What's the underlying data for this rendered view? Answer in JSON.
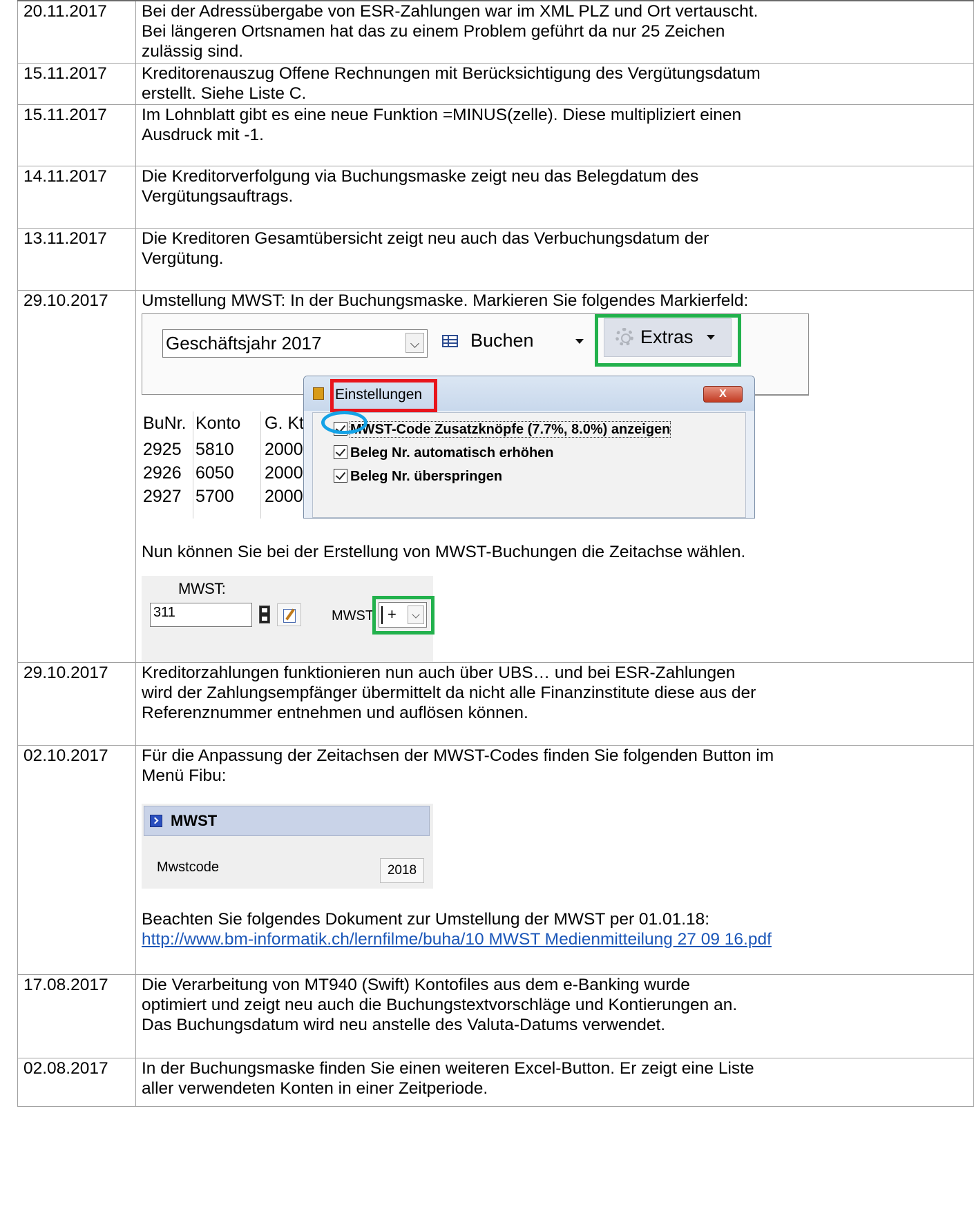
{
  "entries": [
    {
      "date": "20.11.2017",
      "lines": [
        "Bei der Adressübergabe von ESR-Zahlungen war im XML PLZ und Ort vertauscht.",
        "Bei längeren Ortsnamen hat das zu einem Problem geführt da nur 25 Zeichen",
        "zulässig sind."
      ]
    },
    {
      "date": "15.11.2017",
      "lines": [
        "Kreditorenauszug Offene Rechnungen mit Berücksichtigung des Vergütungsdatum",
        "erstellt. Siehe Liste C."
      ]
    },
    {
      "date": "15.11.2017",
      "lines": [
        "Im Lohnblatt gibt es eine neue Funktion  =MINUS(zelle). Diese multipliziert einen",
        "Ausdruck mit -1."
      ]
    },
    {
      "date": "14.11.2017",
      "lines": [
        "Die Kreditorverfolgung via Buchungsmaske zeigt neu das Belegdatum des",
        "Vergütungsauftrags."
      ]
    },
    {
      "date": "13.11.2017",
      "lines": [
        "Die Kreditoren Gesamtübersicht zeigt neu auch das Verbuchungsdatum der",
        "Vergütung."
      ]
    },
    {
      "date": "29.10.2017",
      "lines": [
        "Umstellung MWST: In der Buchungsmaske. Markieren Sie folgendes Markierfeld:"
      ],
      "after_shot1": "Nun können Sie bei der Erstellung von MWST-Buchungen die Zeitachse wählen."
    },
    {
      "date": "29.10.2017",
      "lines": [
        "Kreditorzahlungen funktionieren nun auch über UBS… und bei ESR-Zahlungen",
        "wird der Zahlungsempfänger übermittelt da nicht alle Finanzinstitute diese aus der",
        "Referenznummer entnehmen und auflösen können."
      ]
    },
    {
      "date": "02.10.2017",
      "lines": [
        "Für die Anpassung der Zeitachsen der MWST-Codes finden Sie folgenden Button im",
        "Menü Fibu:"
      ],
      "after_shot": "Beachten Sie folgendes Dokument zur Umstellung der MWST per 01.01.18:",
      "link": "http://www.bm-informatik.ch/lernfilme/buha/10 MWST Medienmitteilung 27 09 16.pdf"
    },
    {
      "date": "17.08.2017",
      "lines": [
        "Die Verarbeitung von MT940 (Swift) Kontofiles aus dem e-Banking wurde",
        "optimiert und zeigt neu auch die Buchungstextvorschläge und Kontierungen an.",
        "Das Buchungsdatum wird neu anstelle des Valuta-Datums verwendet."
      ]
    },
    {
      "date": "02.08.2017",
      "lines": [
        "In der Buchungsmaske finden Sie einen weiteren Excel-Button. Er zeigt eine Liste",
        "aller verwendeten Konten in einer Zeitperiode."
      ]
    }
  ],
  "shot1": {
    "year_combo": "Geschäftsjahr 2017",
    "buchen": "Buchen",
    "extras": "Extras",
    "headers": [
      "BuNr.",
      "Konto",
      "G. Kt"
    ],
    "rows": [
      [
        "2925",
        "5810",
        "2000"
      ],
      [
        "2926",
        "6050",
        "2000"
      ],
      [
        "2927",
        "5700",
        "2000"
      ]
    ],
    "dialog_title": "Einstellungen",
    "dialog_close": "X",
    "options": [
      "MWST-Code Zusatzknöpfe (7.7%, 8.0%) anzeigen",
      "Beleg Nr. automatisch erhöhen",
      "Beleg Nr. überspringen"
    ]
  },
  "shot2": {
    "label": "MWST:",
    "value": "311",
    "label2": "MWST",
    "combo_value": "+"
  },
  "shot3": {
    "header": "MWST",
    "row_label": "Mwstcode",
    "row_button": "2018"
  },
  "colors": {
    "highlight_green": "#22b14c",
    "highlight_red": "#e8151c",
    "highlight_blue": "#14a2e6",
    "link": "#1a56b8"
  }
}
